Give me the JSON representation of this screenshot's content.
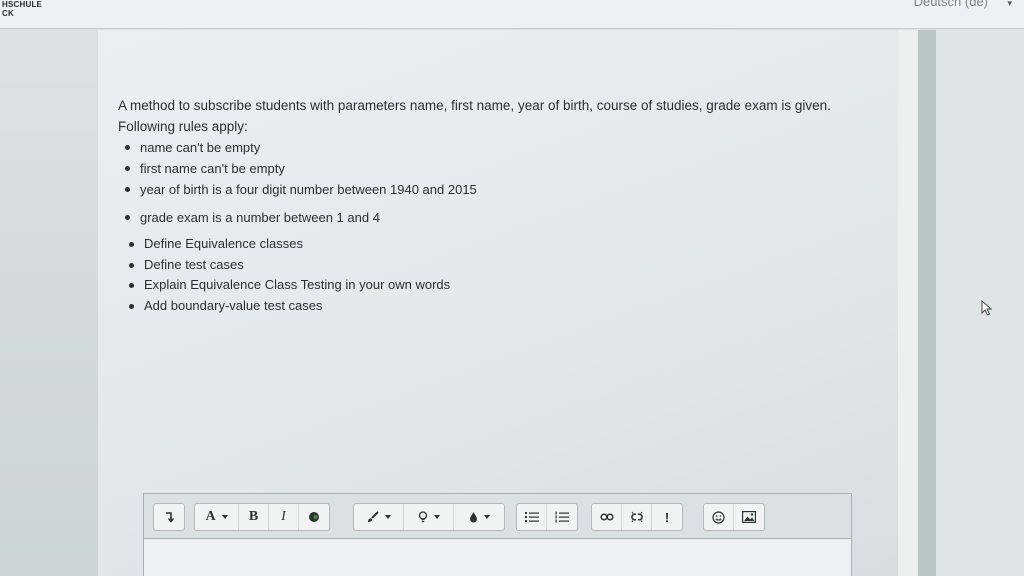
{
  "header": {
    "logo_line1": "HSCHULE",
    "logo_line2": "CK",
    "language": "Deutsch (de)",
    "language_caret": "▾"
  },
  "question": {
    "intro_line1": "A method to subscribe students with parameters name, first name, year of birth, course of studies, grade exam is given.",
    "intro_line2": "Following rules apply:",
    "rules": [
      "name can't be empty",
      "first name can't be empty",
      "year of birth is a four digit number between 1940 and 2015",
      "grade exam is a number between 1 and 4"
    ],
    "tasks": [
      "Define Equivalence classes",
      "Define test cases",
      "Explain Equivalence Class Testing in your own words",
      "Add boundary-value test cases"
    ]
  },
  "toolbar": {
    "font_size_label": "A",
    "bold_label": "B",
    "italic_label": "I",
    "important_label": "!"
  },
  "colors": {
    "text": "#2b2f33",
    "panel": "#e6eaea"
  }
}
